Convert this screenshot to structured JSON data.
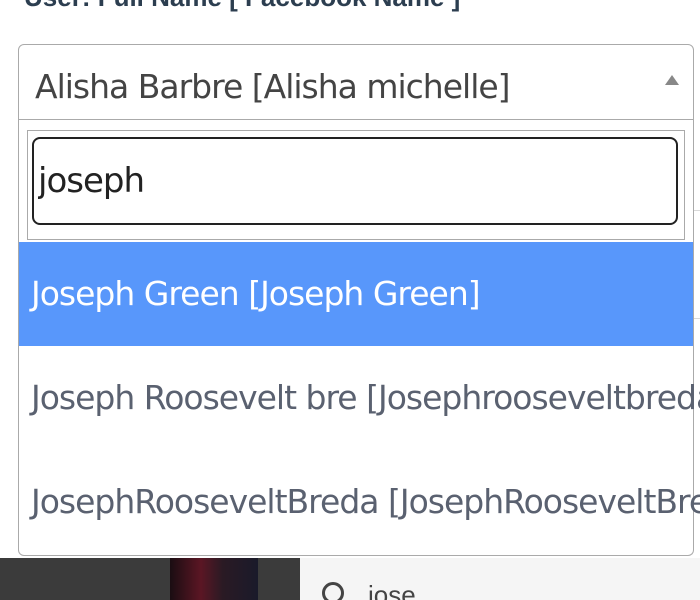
{
  "form": {
    "field_label": "User: Full Name [ Facebook Name ]"
  },
  "select": {
    "selected_value": "Alisha Barbre [Alisha michelle]",
    "arrow_icon": "caret-up-icon"
  },
  "dropdown": {
    "search_value": "joseph",
    "options": [
      {
        "label": "Joseph Green [Joseph Green]",
        "highlighted": true
      },
      {
        "label": "Joseph Roosevelt bre [Josephrooseveltbreda]",
        "highlighted": false
      },
      {
        "label": "JosephRooseveltBreda [JosephRooseveltBreda]",
        "highlighted": false
      }
    ]
  },
  "footer": {
    "search_text": "jose",
    "search_icon": "search-icon"
  },
  "colors": {
    "highlight": "#5897fb",
    "border": "#aaaaaa",
    "label": "#2c3e50",
    "footer_dark": "#3b3b3b"
  }
}
